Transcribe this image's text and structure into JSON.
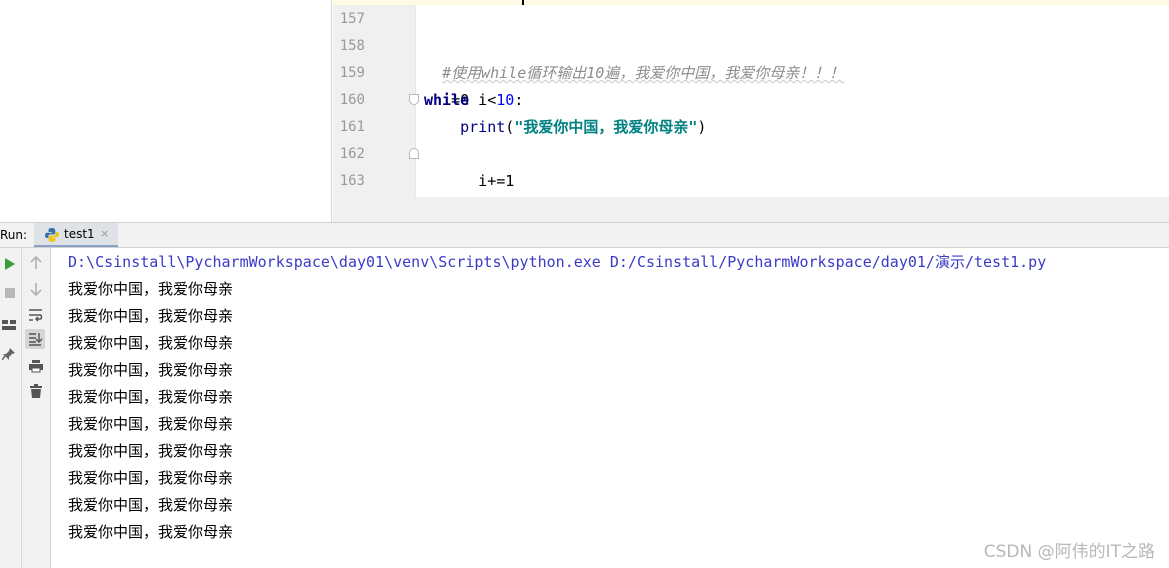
{
  "editor": {
    "line_numbers": [
      "157",
      "158",
      "159",
      "160",
      "161",
      "162",
      "163"
    ],
    "lines": {
      "comment": "#使用while循环输出10遍，我爱你中国，我爱你母亲！！！",
      "assign": "i=0",
      "while_kw": "while",
      "while_var": " i<",
      "while_num": "10",
      "while_colon": ":",
      "print_indent": "    ",
      "print_fn": "print",
      "print_open": "(",
      "print_str": "\"我爱你中国，我爱你母亲\"",
      "print_close": ")",
      "incr": "    i+=1"
    }
  },
  "run_panel": {
    "label": "Run:",
    "tab_label": "test1",
    "tab_close": "×",
    "command": "D:\\Csinstall\\PycharmWorkspace\\day01\\venv\\Scripts\\python.exe D:/Csinstall/PycharmWorkspace/day01/演示/test1.py",
    "output_lines": [
      "我爱你中国，我爱你母亲",
      "我爱你中国，我爱你母亲",
      "我爱你中国，我爱你母亲",
      "我爱你中国，我爱你母亲",
      "我爱你中国，我爱你母亲",
      "我爱你中国，我爱你母亲",
      "我爱你中国，我爱你母亲",
      "我爱你中国，我爱你母亲",
      "我爱你中国，我爱你母亲",
      "我爱你中国，我爱你母亲"
    ]
  },
  "toolbar_icons": {
    "outer": [
      "run-icon",
      "stop-icon",
      "layout-icon",
      "pin-icon"
    ],
    "inner": [
      "up-arrow-icon",
      "down-arrow-icon",
      "soft-wrap-icon",
      "scroll-to-end-icon",
      "print-icon",
      "trash-icon"
    ]
  },
  "colors": {
    "keyword": "#000080",
    "number": "#0000ff",
    "string": "#008080",
    "comment": "#8c8c8c",
    "command_text": "#3a3ac8",
    "run_icon": "#3c9a3c"
  },
  "watermark": "CSDN @阿伟的IT之路"
}
